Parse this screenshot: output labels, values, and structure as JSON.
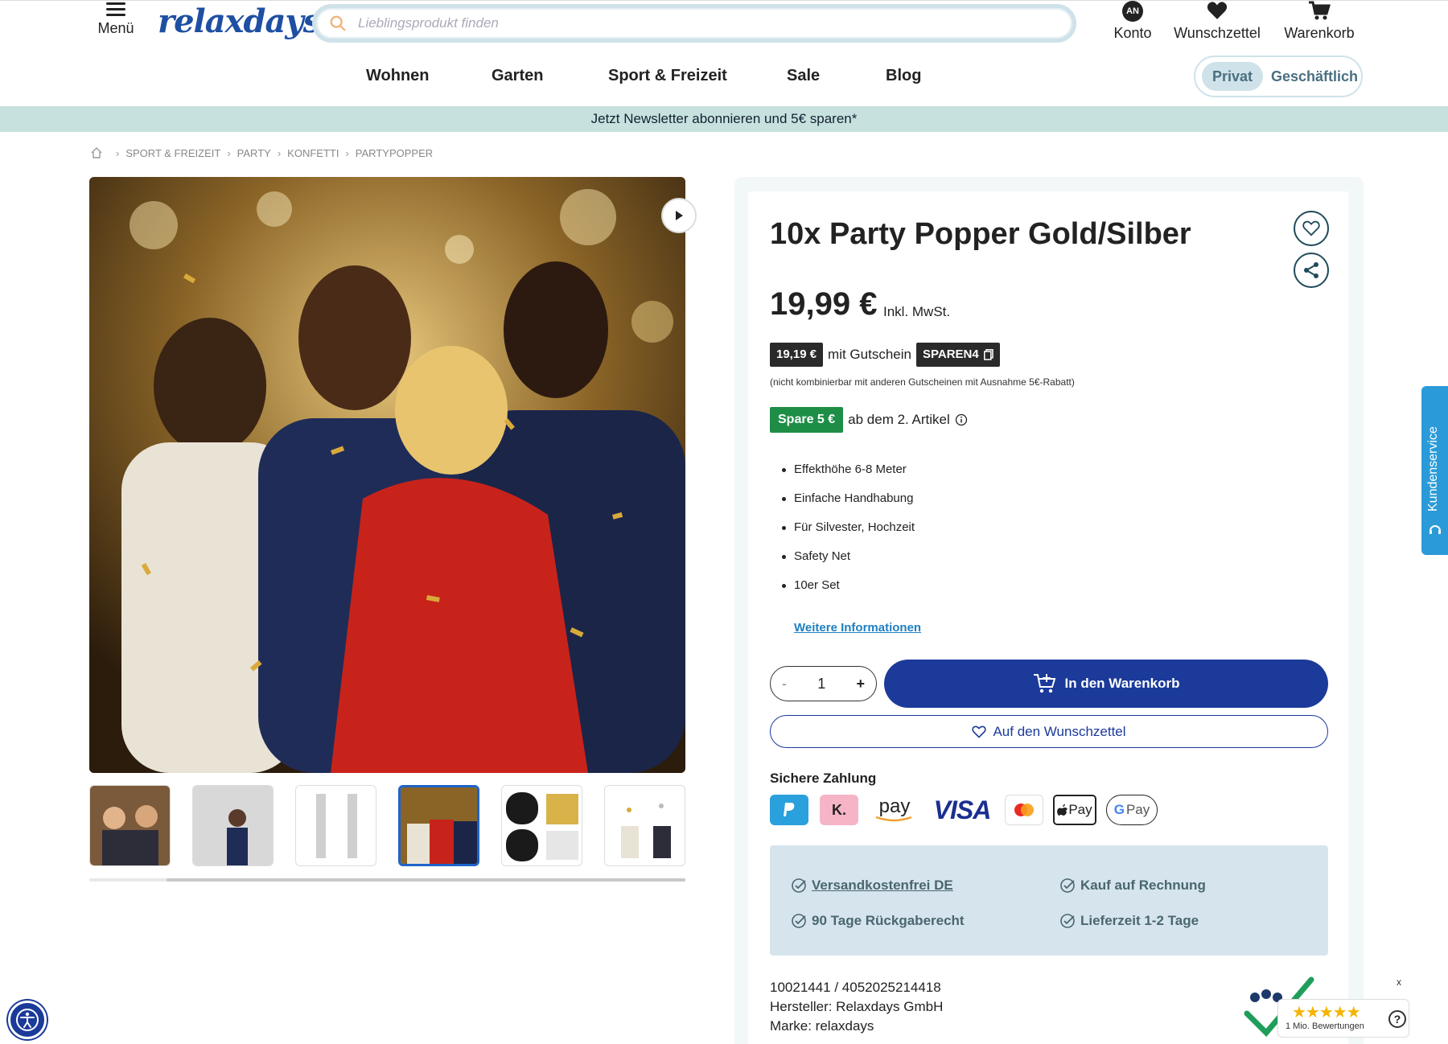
{
  "header": {
    "menu_label": "Menü",
    "logo_text": "relaxdays",
    "search_placeholder": "Lieblingsprodukt finden",
    "account_badge": "AN",
    "account_label": "Konto",
    "wishlist_label": "Wunschzettel",
    "cart_label": "Warenkorb"
  },
  "nav": {
    "items": [
      "Wohnen",
      "Garten",
      "Sport & Freizeit",
      "Sale",
      "Blog"
    ]
  },
  "account_toggle": {
    "options": [
      "Privat",
      "Geschäftlich"
    ],
    "active": "Privat"
  },
  "newsletter_banner": "Jetzt Newsletter abonnieren und 5€ sparen*",
  "breadcrumb": [
    "SPORT & FREIZEIT",
    "PARTY",
    "KONFETTI",
    "PARTYPOPPER"
  ],
  "gallery": {
    "thumb_count": 6,
    "active_thumb": 4
  },
  "product": {
    "title": "10x Party Popper Gold/Silber",
    "price": "19,99 €",
    "price_note": "Inkl. MwSt.",
    "coupon_price": "19,19 €",
    "coupon_text": "mit Gutschein",
    "coupon_code": "SPAREN4",
    "coupon_note": "(nicht kombinierbar mit anderen Gutscheinen mit Ausnahme 5€-Rabatt)",
    "spare_badge": "Spare 5 €",
    "spare_text": "ab dem 2. Artikel",
    "features": [
      "Effekthöhe 6-8 Meter",
      "Einfache Handhabung",
      "Für Silvester, Hochzeit",
      "Safety Net",
      "10er Set"
    ],
    "more_info": "Weitere Informationen",
    "quantity": "1",
    "qty_minus": "-",
    "qty_plus": "+",
    "add_to_cart": "In den Warenkorb",
    "add_to_wishlist": "Auf den Wunschzettel"
  },
  "payment": {
    "title": "Sichere Zahlung",
    "methods": [
      "PayPal",
      "Klarna",
      "Amazon Pay",
      "VISA",
      "Mastercard",
      "Apple Pay",
      "Google Pay"
    ],
    "labels": {
      "klarna": "K.",
      "amazon": "pay",
      "visa": "VISA",
      "apple": "Pay",
      "google": "Pay"
    }
  },
  "benefits": {
    "shipping": "Versandkostenfrei DE",
    "invoice": "Kauf auf Rechnung",
    "return": "90 Tage Rückgaberecht",
    "delivery": "Lieferzeit 1-2 Tage"
  },
  "meta": {
    "ids": "10021441 /  4052025214418",
    "manufacturer": "Hersteller: Relaxdays GmbH",
    "brand": "Marke: relaxdays"
  },
  "side_tab": "Kundenservice",
  "trust_badge": {
    "close": "x",
    "stars": "★★★★★",
    "count": "1 Mio. Bewertungen",
    "help": "?"
  },
  "colors": {
    "brand_blue": "#1b3a9a",
    "newsletter_bg": "#c7e1de",
    "green_badge": "#1e8e47",
    "service_tab": "#2a9bd8",
    "link_blue": "#1e7fc1"
  }
}
